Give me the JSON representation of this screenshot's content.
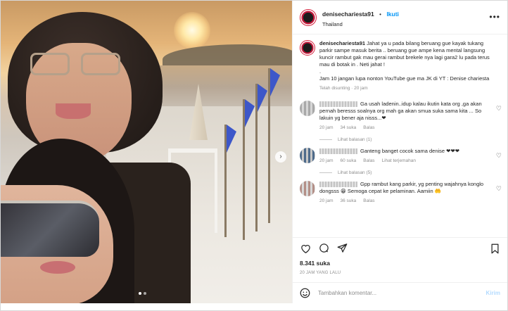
{
  "header": {
    "username": "denisechariesta91",
    "separator": "•",
    "follow_label": "Ikuti",
    "location": "Thailand",
    "more_icon": "more-horizontal-icon"
  },
  "caption": {
    "username": "denisechariesta91",
    "text": "Jahat ya u pada bilang beruang gue kayak tukang parkir sampe masuk berita .. beruang gue ampe kena mental langsung kuncir rambut gak mau gerai rambut brekele nya lagi gara2 lu pada terus mau di botak in . Neti jahat !",
    "spacer": ".",
    "text2": "Jam 10 jangan lupa nonton YouTube gue ma JK di YT : Denise chariesta",
    "edited": "Telah disunting · 20 jam"
  },
  "comments": [
    {
      "text": "Ga usah ladenin..idup kalau ikutin kata org ,ga akan pernah beresss soalnya org mah ga akan smua suka sama kita ... So lakuin yg bener aja nisss...❤",
      "time": "20 jam",
      "likes": "34 suka",
      "reply": "Balas",
      "translate": "",
      "replies": "Lihat balasan (1)"
    },
    {
      "text": "Ganteng banget cocok sama denise ❤❤❤",
      "time": "20 jam",
      "likes": "60 suka",
      "reply": "Balas",
      "translate": "Lihat terjemahan",
      "replies": "Lihat balasan (5)"
    },
    {
      "text": "Gpp rambut kang parkir, yg penting wajahnya konglo dongsss 😁 Semoga cepat ke pelaminan. Aamiin 🤲",
      "time": "20 jam",
      "likes": "36 suka",
      "reply": "Balas",
      "translate": "",
      "replies": ""
    }
  ],
  "actions": {
    "like_icon": "heart-icon",
    "comment_icon": "comment-icon",
    "share_icon": "send-icon",
    "save_icon": "bookmark-icon"
  },
  "likes": "8.341 suka",
  "posted": "20 JAM YANG LALU",
  "composer": {
    "placeholder": "Tambahkan komentar...",
    "send_label": "Kirim",
    "emoji_icon": "emoji-icon"
  }
}
